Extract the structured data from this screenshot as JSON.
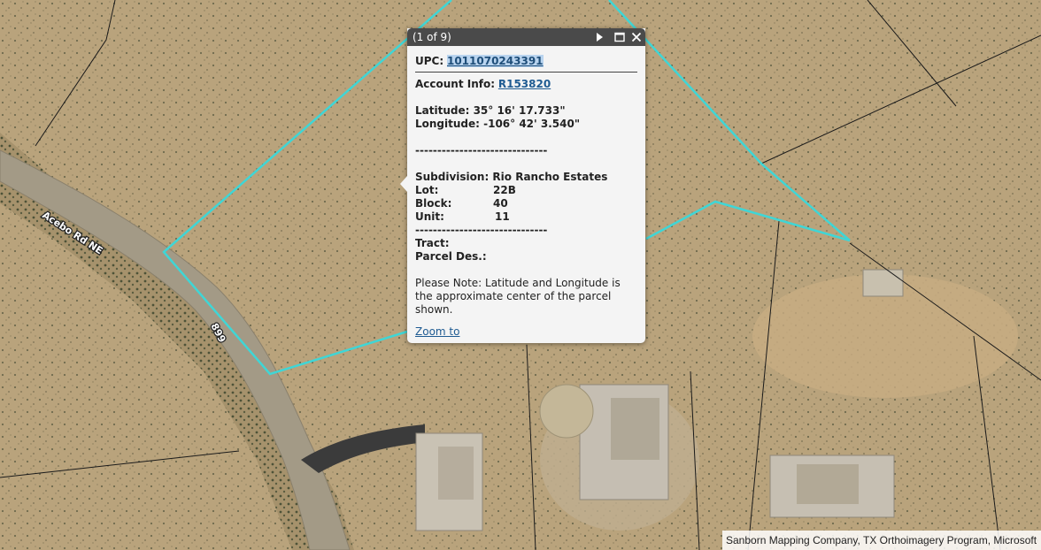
{
  "popup": {
    "title": "(1 of 9)",
    "upc_label": "UPC:",
    "upc_value": "1011070243391",
    "account_label": "Account Info:",
    "account_value": "R153820",
    "latitude": "Latitude: 35° 16' 17.733\"",
    "longitude": "Longitude: -106° 42' 3.540\"",
    "separator": "------------------------------",
    "subdivision": "Subdivision: Rio Rancho Estates",
    "fields": [
      {
        "label": "Lot:",
        "value": "22B"
      },
      {
        "label": "Block:",
        "value": "40"
      },
      {
        "label": "Unit:",
        "value": "11"
      }
    ],
    "separator2": "------------------------------",
    "tract_label": "Tract:",
    "parcel_label": "Parcel Des.:",
    "note": "Please Note: Latitude and Longitude is the approximate center of the parcel shown.",
    "zoom_link": "Zoom to"
  },
  "map": {
    "road_name": "Acebo Rd NE",
    "house_number": "899",
    "attribution": "Sanborn Mapping Company, TX Orthoimagery Program, Microsoft",
    "parcel_color": "#3fd6d6",
    "terrain_color": "#b7a17a"
  },
  "icons": {
    "next": "play-icon",
    "maximize": "maximize-icon",
    "close": "close-icon"
  }
}
